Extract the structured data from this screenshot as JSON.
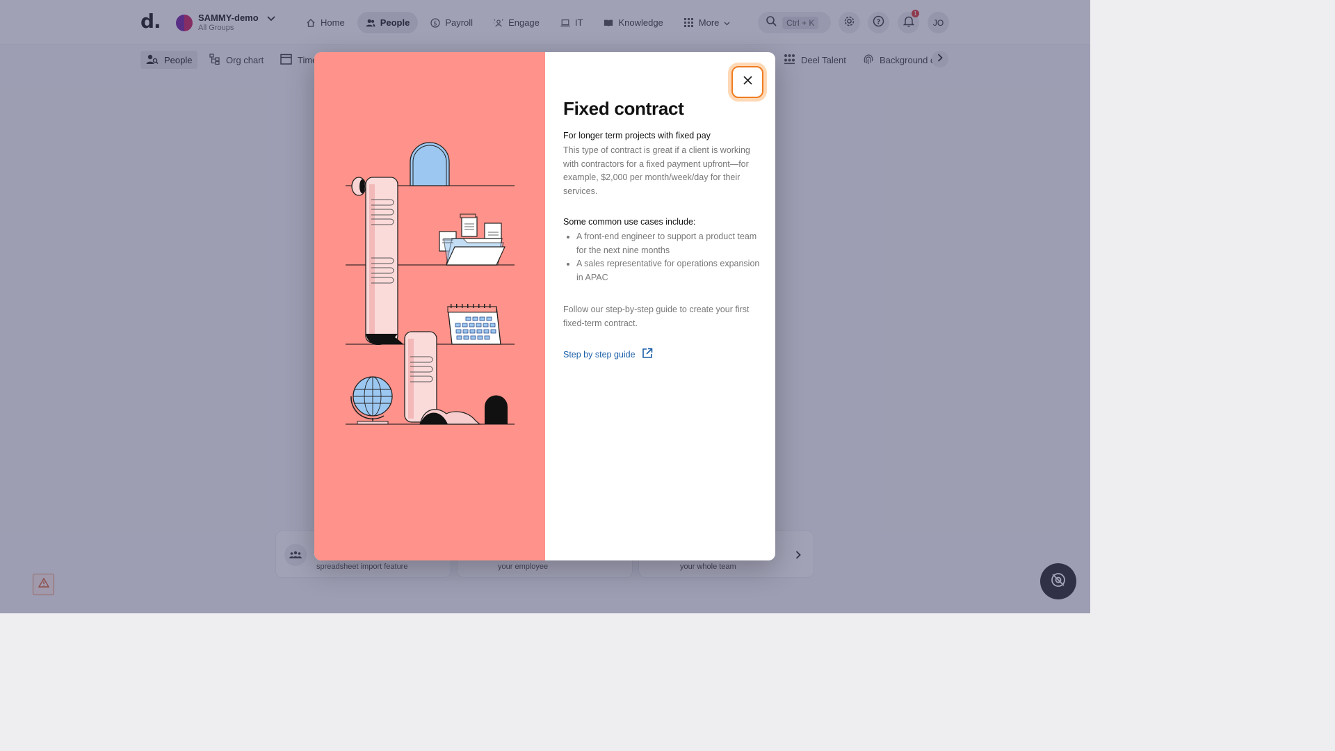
{
  "app": {
    "logo": "d.",
    "org_name": "SAMMY-demo",
    "org_sub": "All Groups",
    "user_initials": "JO",
    "notification_count": "1"
  },
  "nav": [
    {
      "label": "Home",
      "icon": "home-icon"
    },
    {
      "label": "People",
      "icon": "people-icon",
      "active": true
    },
    {
      "label": "Payroll",
      "icon": "payroll-icon"
    },
    {
      "label": "Engage",
      "icon": "engage-icon"
    },
    {
      "label": "IT",
      "icon": "laptop-icon"
    },
    {
      "label": "Knowledge",
      "icon": "book-icon"
    },
    {
      "label": "More",
      "icon": "grid-icon"
    }
  ],
  "search": {
    "shortcut": "Ctrl + K"
  },
  "subnav": [
    {
      "label": "People",
      "icon": "people-search-icon",
      "active": true
    },
    {
      "label": "Org chart",
      "icon": "org-chart-icon"
    },
    {
      "label": "Time",
      "icon": "calendar-icon"
    },
    {
      "label": "Deel Talent",
      "icon": "talent-icon"
    },
    {
      "label": "Background c",
      "icon": "fingerprint-icon"
    }
  ],
  "cards": [
    {
      "text": "spreadsheet import feature"
    },
    {
      "text": "your employee"
    },
    {
      "text": "your whole team"
    }
  ],
  "modal": {
    "title": "Fixed contract",
    "subtitle": "For longer term projects with fixed pay",
    "description": "This type of contract is great if a client is working with contractors for a fixed payment upfront—for example, $2,000 per month/week/day for their services.",
    "use_cases_heading": "Some common use cases include:",
    "use_cases": [
      "A front-end engineer to support a product team for the next nine months",
      "A sales representative for operations expansion in APAC"
    ],
    "follow_text": "Follow our step-by-step guide to create your first fixed-term contract.",
    "guide_link": "Step by step guide"
  },
  "colors": {
    "art_bg": "#ff928a",
    "accent_orange": "#f07c21",
    "link_blue": "#1a5fa8"
  }
}
